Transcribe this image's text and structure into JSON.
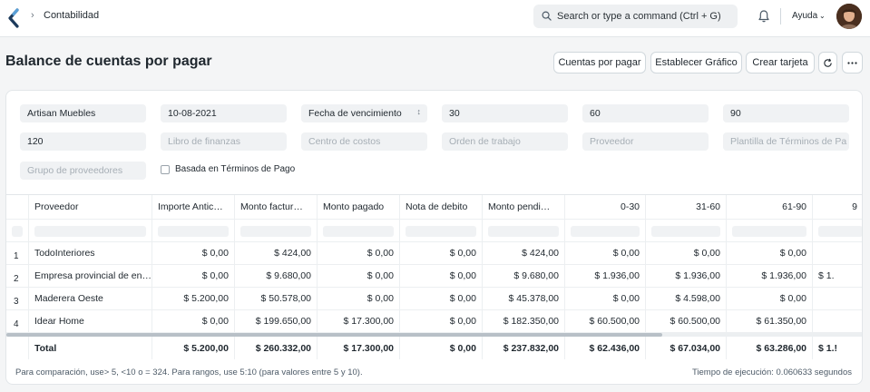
{
  "breadcrumb": {
    "label": "Contabilidad"
  },
  "search": {
    "placeholder": "Search or type a command (Ctrl + G)"
  },
  "help": {
    "label": "Ayuda"
  },
  "page": {
    "title": "Balance de cuentas por pagar"
  },
  "actions": {
    "accounts_payable": "Cuentas por pagar",
    "set_chart": "Establecer Gráfico",
    "create_card": "Crear tarjeta",
    "refresh_icon": "refresh-icon",
    "more_icon": "more-icon"
  },
  "filters": {
    "company": "Artisan Muebles",
    "date": "10-08-2021",
    "ageing_based_on": "Fecha de vencimiento",
    "range1": "30",
    "range2": "60",
    "range3": "90",
    "range4": "120",
    "finance_book_ph": "Libro de finanzas",
    "cost_center_ph": "Centro de costos",
    "work_order_ph": "Orden de trabajo",
    "supplier_ph": "Proveedor",
    "payment_terms_template_ph": "Plantilla de Términos de Pa",
    "supplier_group_ph": "Grupo de proveedores",
    "based_on_payment_terms": "Basada en Términos de Pago"
  },
  "table": {
    "columns": [
      "Proveedor",
      "Importe Antic…",
      "Monto factur…",
      "Monto pagado",
      "Nota de debito",
      "Monto pendi…",
      "0-30",
      "31-60",
      "61-90",
      "9"
    ],
    "rows": [
      {
        "num": "1",
        "cells": [
          "TodoInteriores",
          "$ 0,00",
          "$ 424,00",
          "$ 0,00",
          "$ 0,00",
          "$ 424,00",
          "$ 0,00",
          "$ 0,00",
          "$ 0,00",
          ""
        ]
      },
      {
        "num": "2",
        "cells": [
          "Empresa provincial de en…",
          "$ 0,00",
          "$ 9.680,00",
          "$ 0,00",
          "$ 0,00",
          "$ 9.680,00",
          "$ 1.936,00",
          "$ 1.936,00",
          "$ 1.936,00",
          "$ 1."
        ]
      },
      {
        "num": "3",
        "cells": [
          "Maderera Oeste",
          "$ 5.200,00",
          "$ 50.578,00",
          "$ 0,00",
          "$ 0,00",
          "$ 45.378,00",
          "$ 0,00",
          "$ 4.598,00",
          "$ 0,00",
          ""
        ]
      },
      {
        "num": "4",
        "cells": [
          "Idear Home",
          "$ 0,00",
          "$ 199.650,00",
          "$ 17.300,00",
          "$ 0,00",
          "$ 182.350,00",
          "$ 60.500,00",
          "$ 60.500,00",
          "$ 61.350,00",
          ""
        ]
      }
    ],
    "total": [
      "Total",
      "$ 5.200,00",
      "$ 260.332,00",
      "$ 17.300,00",
      "$ 0,00",
      "$ 237.832,00",
      "$ 62.436,00",
      "$ 67.034,00",
      "$ 63.286,00",
      "$ 1.!"
    ]
  },
  "footer": {
    "note": "Para comparación, use> 5, <10 o = 324. Para rangos, use 5:10 (para valores entre 5 y 10).",
    "execution_time": "Tiempo de ejecución: 0.060633 segundos"
  },
  "colors": {
    "accent": "#1f272e",
    "background": "#f4f5f6",
    "field": "#f0f2f4",
    "border": "#d1d8dd"
  }
}
